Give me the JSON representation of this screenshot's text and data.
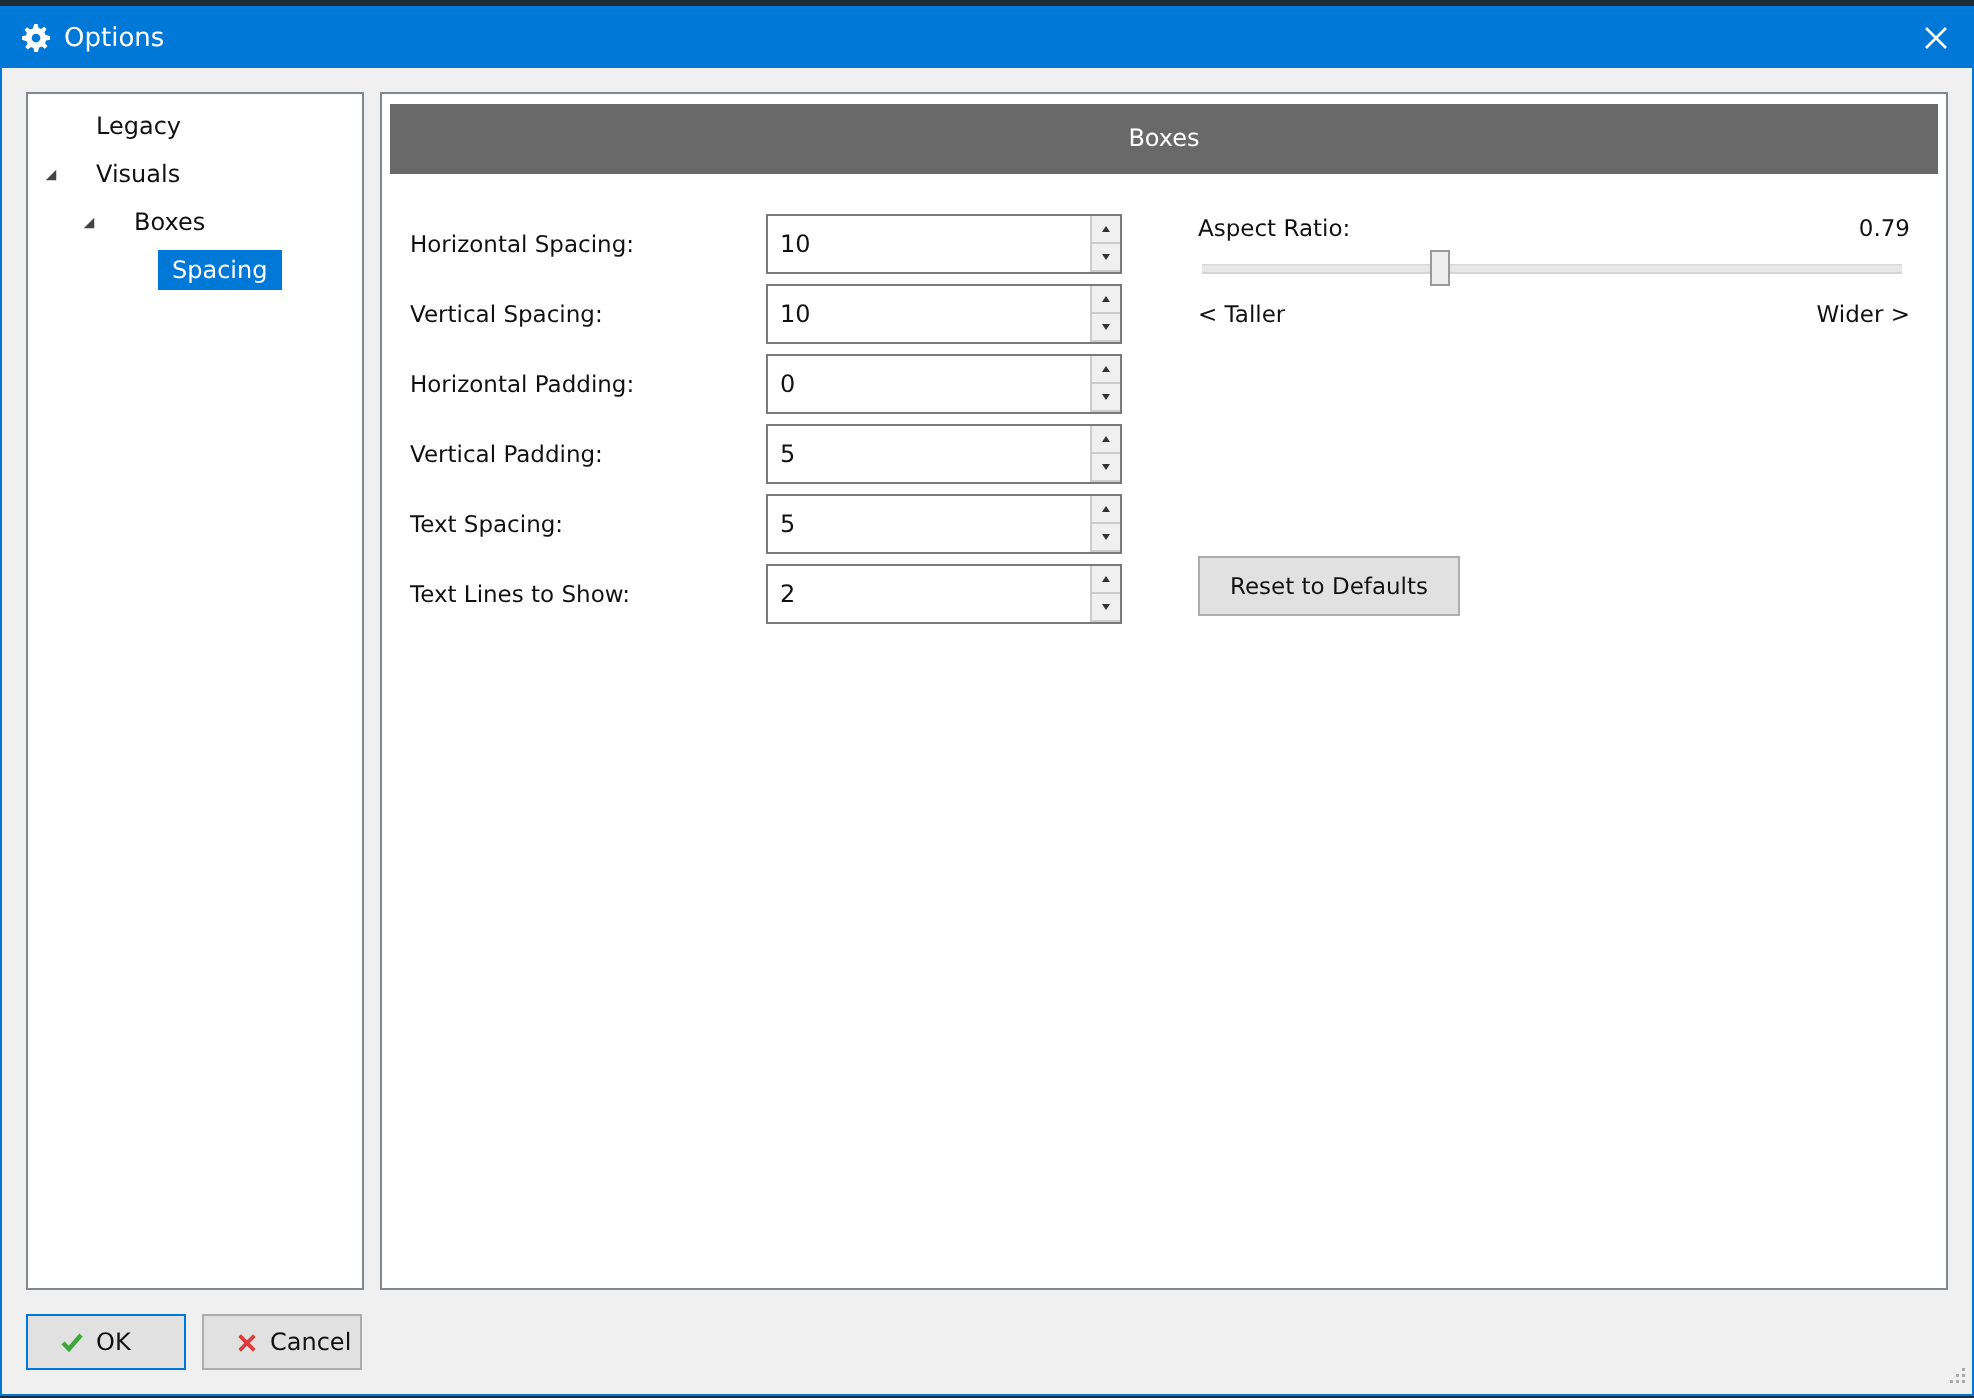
{
  "window": {
    "title": "Options"
  },
  "tree": [
    {
      "label": "Legacy",
      "selected": false
    },
    {
      "label": "Visuals",
      "selected": false,
      "expanded": true,
      "children": [
        {
          "label": "Boxes",
          "selected": false,
          "expanded": true,
          "children": [
            {
              "label": "Spacing",
              "selected": true
            }
          ]
        }
      ]
    }
  ],
  "section": {
    "title": "Boxes"
  },
  "fields": [
    {
      "label": "Horizontal Spacing:",
      "value": "10"
    },
    {
      "label": "Vertical Spacing:",
      "value": "10"
    },
    {
      "label": "Horizontal Padding:",
      "value": "0"
    },
    {
      "label": "Vertical Padding:",
      "value": "5"
    },
    {
      "label": "Text Spacing:",
      "value": "5"
    },
    {
      "label": "Text Lines to Show:",
      "value": "2"
    }
  ],
  "slider": {
    "label": "Aspect Ratio:",
    "reading": "0.79",
    "level": 0.34,
    "min_label": "< Taller",
    "max_label": "Wider >"
  },
  "reset_button": "Reset to Defaults",
  "buttons": [
    {
      "kind": "ok",
      "label": "OK"
    },
    {
      "kind": "cancel",
      "label": "Cancel"
    }
  ]
}
